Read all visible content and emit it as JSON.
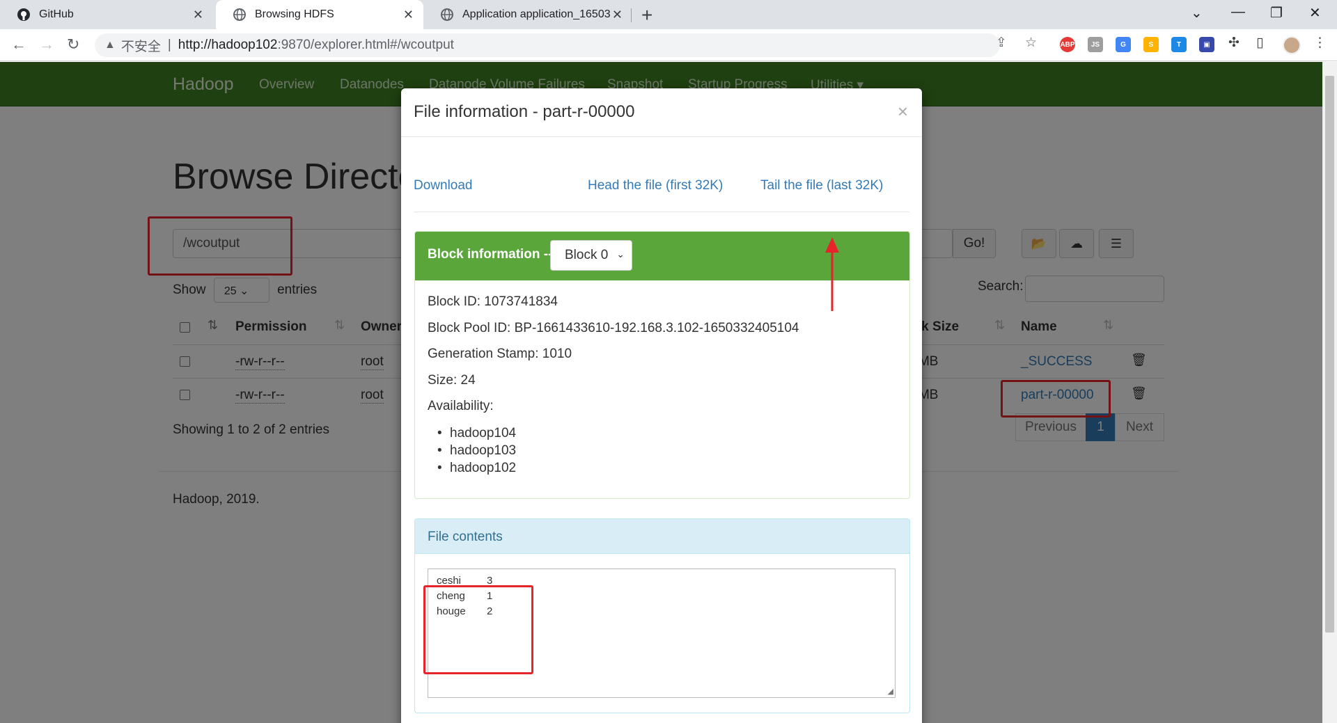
{
  "browser": {
    "tabs": [
      {
        "title": "GitHub",
        "icon": "github-icon"
      },
      {
        "title": "Browsing HDFS",
        "icon": "globe-icon"
      },
      {
        "title": "Application application_16503",
        "icon": "globe-icon"
      }
    ],
    "omnibox": {
      "insecure_label": "不安全",
      "url_host": "http://hadoop102",
      "url_rest": ":9870/explorer.html#/wcoutput"
    },
    "extensions": [
      {
        "name": "adblock-icon",
        "label": "ABP",
        "color": "#e53935"
      },
      {
        "name": "js-icon",
        "label": "JS",
        "color": "#9e9e9e"
      },
      {
        "name": "translate-icon",
        "label": "G",
        "color": "#4285f4"
      },
      {
        "name": "orange-ext-icon",
        "label": "S",
        "color": "#ffb300"
      },
      {
        "name": "tag-ext-icon",
        "label": "T",
        "color": "#1e88e5"
      },
      {
        "name": "save-ext-icon",
        "label": "▣",
        "color": "#3949ab"
      }
    ]
  },
  "hadoop": {
    "brand": "Hadoop",
    "nav": [
      "Overview",
      "Datanodes",
      "Datanode Volume Failures",
      "Snapshot",
      "Startup Progress",
      "Utilities ▾"
    ],
    "title": "Browse Directory",
    "path_value": "/wcoutput",
    "go_label": "Go!",
    "show_label": "Show",
    "show_value": "25",
    "entries_label": "entries",
    "search_label": "Search:",
    "columns": {
      "permission": "Permission",
      "owner": "Owner",
      "block_size": "Block Size",
      "name": "Name"
    },
    "rows": [
      {
        "permission": "-rw-r--r--",
        "owner": "root",
        "block_size": "128 MB",
        "name": "_SUCCESS"
      },
      {
        "permission": "-rw-r--r--",
        "owner": "root",
        "block_size": "128 MB",
        "name": "part-r-00000"
      }
    ],
    "showing": "Showing 1 to 2 of 2 entries",
    "pager": {
      "previous": "Previous",
      "current": "1",
      "next": "Next"
    },
    "footer": "Hadoop, 2019."
  },
  "modal": {
    "title": "File information - part-r-00000",
    "close": "×",
    "download": "Download",
    "head": "Head the file (first 32K)",
    "tail": "Tail the file (last 32K)",
    "block_panel": {
      "label": "Block information --",
      "select_value": "Block 0",
      "block_id": "Block ID: 1073741834",
      "pool_id": "Block Pool ID: BP-1661433610-192.168.3.102-1650332405104",
      "gen_stamp": "Generation Stamp: 1010",
      "size": "Size: 24",
      "availability": "Availability:",
      "hosts": [
        "hadoop104",
        "hadoop103",
        "hadoop102"
      ]
    },
    "contents_panel": {
      "label": "File contents",
      "lines": [
        {
          "word": "ceshi",
          "count": "3"
        },
        {
          "word": "cheng",
          "count": "1"
        },
        {
          "word": "houge",
          "count": "2"
        }
      ]
    }
  },
  "colors": {
    "hadoop_green": "#3f8021",
    "success_green": "#5aa63b",
    "link_blue": "#337ab7",
    "annotation_red": "#e8242b"
  }
}
